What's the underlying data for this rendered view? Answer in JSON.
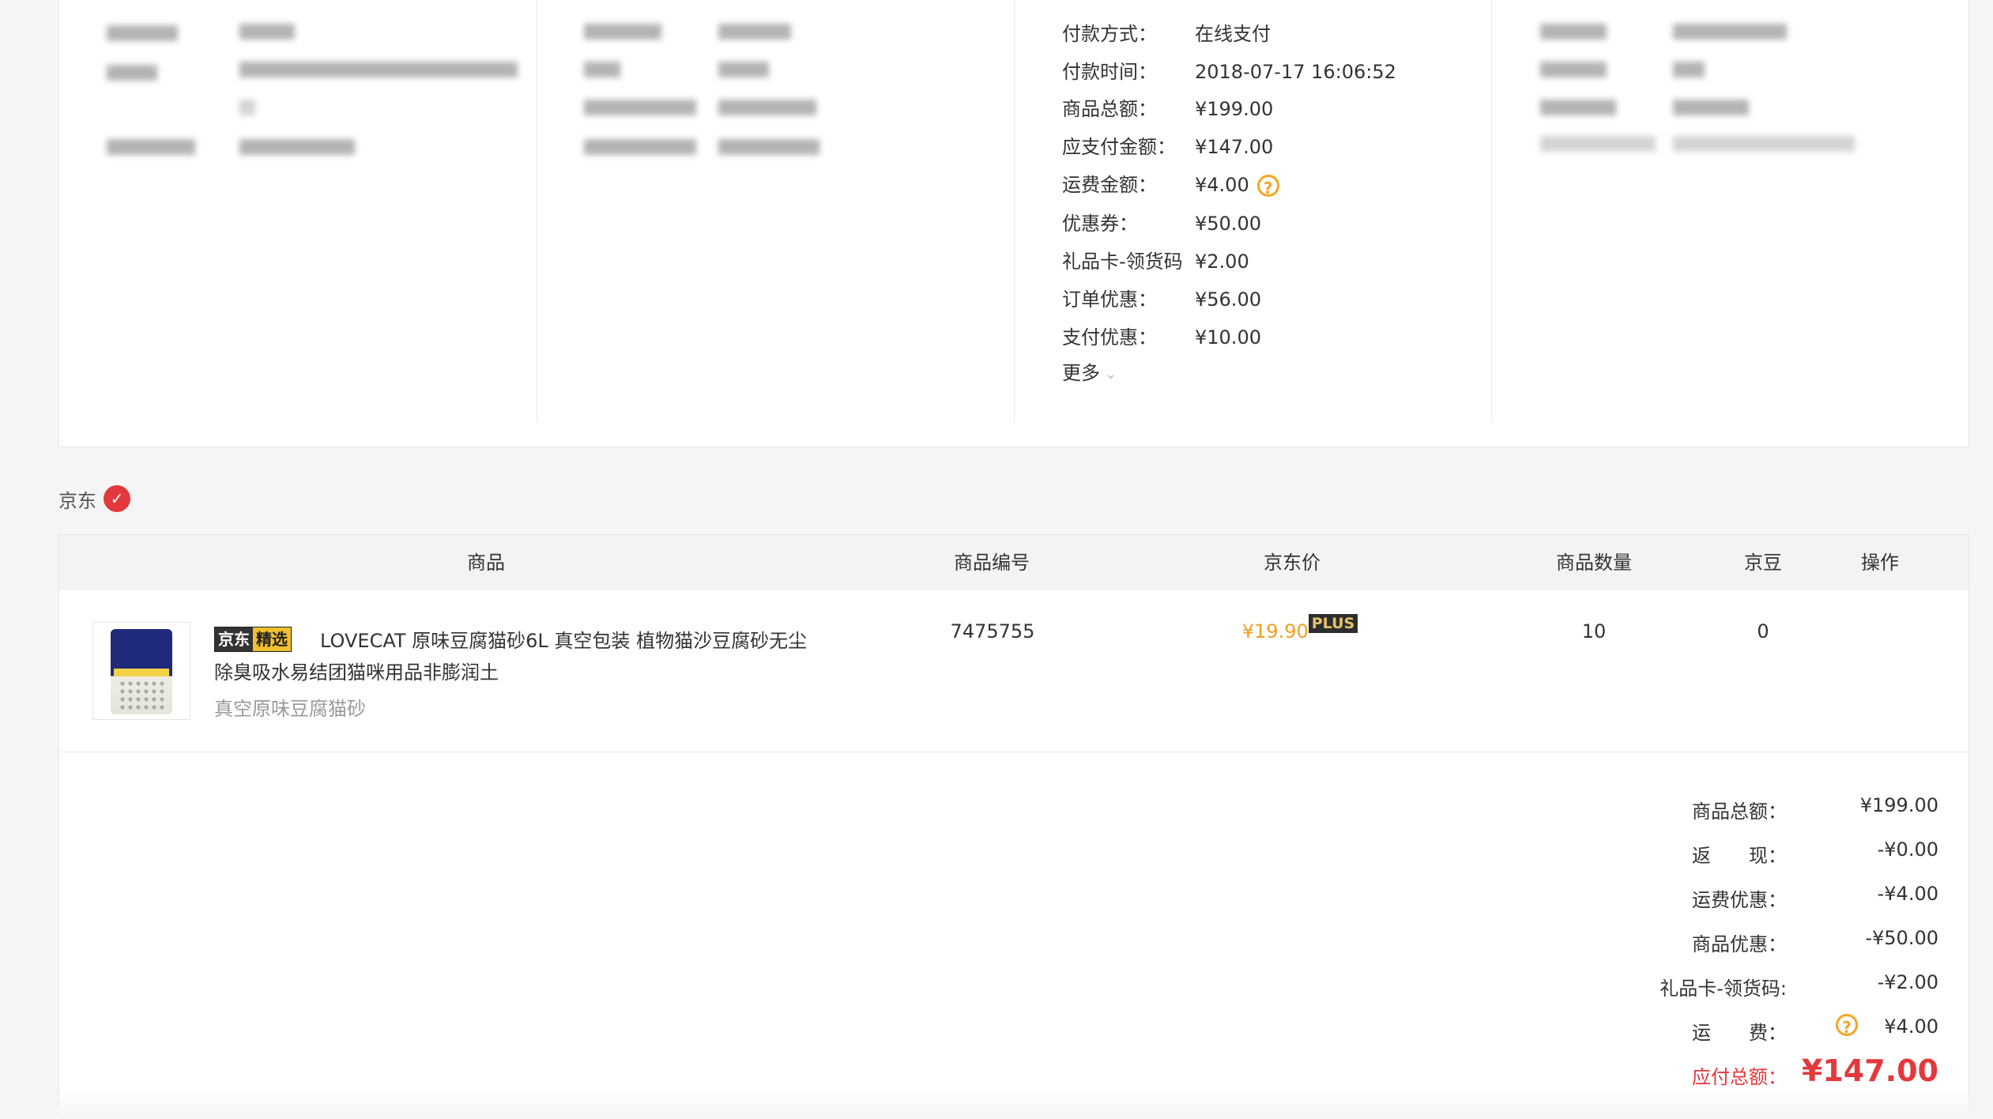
{
  "payment": {
    "method_label": "付款方式：",
    "method_value": "在线支付",
    "time_label": "付款时间：",
    "time_value": "2018-07-17 16:06:52",
    "goods_total_label": "商品总额：",
    "goods_total_value": "¥199.00",
    "payable_label": "应支付金额：",
    "payable_value": "¥147.00",
    "shipping_label": "运费金额：",
    "shipping_value": "¥4.00",
    "coupon_label": "优惠券：",
    "coupon_value": "¥50.00",
    "giftcard_label": "礼品卡-领货码",
    "giftcard_value": "¥2.00",
    "order_discount_label": "订单优惠：",
    "order_discount_value": "¥56.00",
    "pay_discount_label": "支付优惠：",
    "pay_discount_value": "¥10.00",
    "more_label": "更多"
  },
  "shop": {
    "name": "京东"
  },
  "table": {
    "headers": [
      "商品",
      "商品编号",
      "京东价",
      "商品数量",
      "京豆",
      "操作"
    ],
    "item": {
      "badge_left": "京东",
      "badge_right": "精选",
      "title": "LOVECAT 原味豆腐猫砂6L 真空包装 植物猫沙豆腐砂无尘除臭吸水易结团猫咪用品非膨润土",
      "subtitle": "真空原味豆腐猫砂",
      "sku": "7475755",
      "price": "¥19.90",
      "plus_badge": "PLUS",
      "quantity": "10",
      "jingdou": "0"
    }
  },
  "summary": {
    "goods_total_label": "商品总额：",
    "goods_total_value": "¥199.00",
    "cashback_label": "返　　现：",
    "cashback_value": "-¥0.00",
    "shipping_discount_label": "运费优惠：",
    "shipping_discount_value": "-¥4.00",
    "goods_discount_label": "商品优惠：",
    "goods_discount_value": "-¥50.00",
    "giftcard_label": "礼品卡-领货码:",
    "giftcard_value": "-¥2.00",
    "freight_label": "运　　费：",
    "freight_value": "¥4.00",
    "total_label": "应付总额：",
    "total_value": "¥147.00"
  },
  "icons": {
    "help": "question-circle-icon",
    "more": "chevron-double-down-icon",
    "shop": "jd-logo-icon"
  },
  "colors": {
    "accent_red": "#e4393c",
    "price_orange": "#f0a020",
    "help_orange": "#f5a623"
  }
}
